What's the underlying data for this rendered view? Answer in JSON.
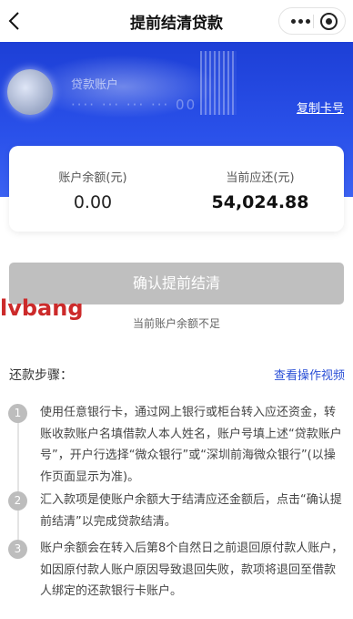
{
  "nav": {
    "title": "提前结清贷款"
  },
  "account": {
    "label": "贷款账户",
    "number": "···· ··· ··· ··· 00",
    "copy_label": "复制卡号"
  },
  "balance": {
    "account_balance_label": "账户余额(元)",
    "account_balance_value": "0.00",
    "due_label": "当前应还(元)",
    "due_value": "54,024.88"
  },
  "action": {
    "confirm_label": "确认提前结清",
    "status_text": "当前账户余额不足"
  },
  "watermark": "lvbang",
  "steps": {
    "title": "还款步骤：",
    "video_link": "查看操作视频",
    "items": [
      {
        "num": "1",
        "text": "使用任意银行卡，通过网上银行或柜台转入应还资金，转账收款账户名填借款人本人姓名，账户号填上述“贷款账户号”，开户行选择“微众银行”或“深圳前海微众银行”(以操作页面显示为准)。"
      },
      {
        "num": "2",
        "text": "汇入款项是使账户余额大于结清应还金额后，点击“确认提前结清”以完成贷款结清。"
      },
      {
        "num": "3",
        "text": "账户余额会在转入后第8个自然日之前退回原付款人账户，如因原付款人账户原因导致退回失败，款项将退回至借款人绑定的还款银行卡账户。"
      }
    ]
  }
}
